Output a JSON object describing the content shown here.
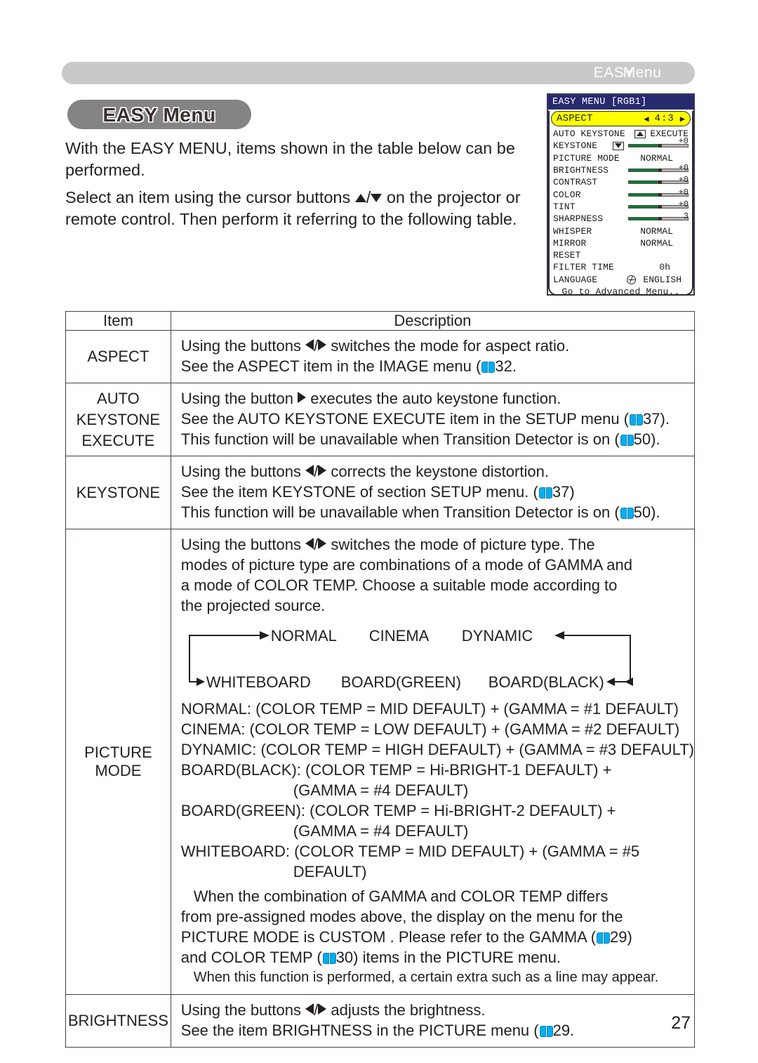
{
  "running_head": {
    "part_a": "EASY",
    "part_b": "Menu"
  },
  "section": {
    "title": "EASY Menu"
  },
  "intro": {
    "p1": "With the EASY MENU, items shown in the table below can be performed.",
    "p2_a": "Select an item using the cursor buttons ",
    "p2_b": " on the projector or remote control. Then perform it referring to the following table."
  },
  "osd": {
    "title": "EASY MENU [RGB1]",
    "aspect": {
      "label": "ASPECT",
      "value": "4:3",
      "left_arrow": "left-arrow-icon",
      "right_arrow": "right-arrow-icon"
    },
    "rows": [
      {
        "name": "AUTO KEYSTONE",
        "icon": "keystone-icon",
        "value": "EXECUTE",
        "type": "text"
      },
      {
        "name": "KEYSTONE",
        "icon": "keystone-icon-inv",
        "value": "+0",
        "type": "slider",
        "fill": 52,
        "knob": 52
      },
      {
        "name": "PICTURE MODE",
        "value": "NORMAL",
        "type": "text"
      },
      {
        "name": "BRIGHTNESS",
        "value": "+0",
        "type": "slider",
        "fill": 52,
        "knob": 52
      },
      {
        "name": "CONTRAST",
        "value": "+0",
        "type": "slider",
        "fill": 52,
        "knob": 52
      },
      {
        "name": "COLOR",
        "value": "+0",
        "type": "slider",
        "fill": 52,
        "knob": 52
      },
      {
        "name": "TINT",
        "value": "+0",
        "type": "slider",
        "fill": 52,
        "knob": 52
      },
      {
        "name": "SHARPNESS",
        "value": "3",
        "type": "slider",
        "fill": 52,
        "knob": 52
      },
      {
        "name": "WHISPER",
        "value": "NORMAL",
        "type": "text"
      },
      {
        "name": "MIRROR",
        "value": "NORMAL",
        "type": "text"
      },
      {
        "name": "RESET",
        "value": "",
        "type": "text"
      },
      {
        "name": "FILTER TIME",
        "value": "0h",
        "type": "text"
      },
      {
        "name": "LANGUAGE",
        "value": "ENGLISH",
        "type": "text",
        "icon": "globe-icon"
      }
    ],
    "footer": "Go to Advanced Menu..",
    "colors": {
      "title_bar": "#272a6e",
      "highlight": "#ffff00",
      "slider_fill": "#0a7a32"
    }
  },
  "table": {
    "headers": {
      "item": "Item",
      "description": "Description"
    },
    "rows": [
      {
        "item": "ASPECT",
        "lines": [
          {
            "pre": "Using the buttons ",
            "mid": " switches the mode for aspect ratio.",
            "arrows": "lr"
          },
          {
            "pre": "See the ASPECT item in the IMAGE menu (",
            "page": "32",
            "post": "."
          }
        ]
      },
      {
        "item_lines": [
          "AUTO",
          "KEYSTONE",
          "EXECUTE"
        ],
        "lines": [
          {
            "pre": "Using the button ",
            "mid": " executes the auto keystone function.",
            "arrows": "r"
          },
          {
            "pre": "See the AUTO KEYSTONE EXECUTE item in the SETUP menu (",
            "page": "37",
            "post": ")."
          },
          {
            "pre": "This function will be unavailable when Transition Detector is on (",
            "page": "50",
            "post": ")."
          }
        ]
      },
      {
        "item": "KEYSTONE",
        "lines": [
          {
            "pre": "Using the buttons ",
            "mid": " corrects the keystone distortion.",
            "arrows": "lr"
          },
          {
            "pre": "See the item KEYSTONE of section SETUP menu. (",
            "page": "37",
            "post": ")"
          },
          {
            "pre": "This function will be unavailable when Transition Detector is on (",
            "page": "50",
            "post": ")."
          }
        ]
      },
      {
        "item": "PICTURE MODE",
        "para_pre": "Using the buttons ",
        "para_post": " switches the mode of picture type. The modes of picture type are combinations of a mode of GAMMA and a mode of COLOR TEMP. Choose a suitable mode according to the projected source.",
        "cycle": {
          "top": [
            "NORMAL",
            "CINEMA",
            "DYNAMIC"
          ],
          "bottom": [
            "WHITEBOARD",
            "BOARD(GREEN)",
            "BOARD(BLACK)"
          ]
        },
        "modes": [
          "NORMAL: (COLOR TEMP = MID DEFAULT) + (GAMMA = #1 DEFAULT)",
          "CINEMA: (COLOR TEMP = LOW DEFAULT) + (GAMMA = #2 DEFAULT)",
          "DYNAMIC: (COLOR TEMP = HIGH DEFAULT) + (GAMMA = #3 DEFAULT)",
          "BOARD(BLACK): (COLOR TEMP = Hi-BRIGHT-1 DEFAULT) +",
          "(GAMMA = #4 DEFAULT)",
          "BOARD(GREEN): (COLOR TEMP = Hi-BRIGHT-2 DEFAULT) +",
          "(GAMMA = #4 DEFAULT)",
          "WHITEBOARD: (COLOR TEMP = MID DEFAULT) + (GAMMA = #5",
          "DEFAULT)"
        ],
        "note_a": "When the combination of GAMMA and COLOR TEMP differs from pre-assigned modes above, the display on the menu for the PICTURE MODE is  CUSTOM . Please refer to the GAMMA (",
        "note_page_a": "29",
        "note_b": ") and COLOR TEMP (",
        "note_page_b": "30",
        "note_c": ") items in the PICTURE menu.",
        "note_d": "When this function is performed, a certain extra such as a line may appear."
      },
      {
        "item": "BRIGHTNESS",
        "lines": [
          {
            "pre": "Using the buttons ",
            "mid": " adjusts the brightness.",
            "arrows": "lr"
          },
          {
            "pre": "See the item BRIGHTNESS in the PICTURE menu (",
            "page": "29",
            "post": "."
          }
        ]
      }
    ]
  },
  "page_number": "27"
}
